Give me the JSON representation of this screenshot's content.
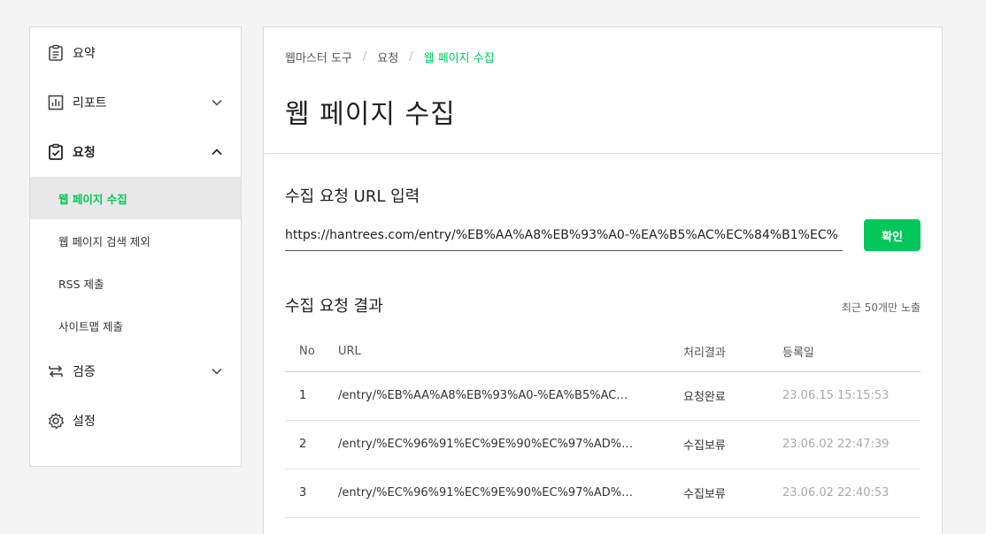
{
  "sidebar": {
    "items": [
      {
        "label": "요약",
        "icon": "clipboard-icon"
      },
      {
        "label": "리포트",
        "icon": "bar-chart-icon",
        "expanded": false
      },
      {
        "label": "요청",
        "icon": "clipboard-check-icon",
        "expanded": true,
        "children": [
          {
            "label": "웹 페이지 수집",
            "active": true
          },
          {
            "label": "웹 페이지 검색 제외"
          },
          {
            "label": "RSS 제출"
          },
          {
            "label": "사이트맵 제출"
          }
        ]
      },
      {
        "label": "검증",
        "icon": "swap-arrows-icon",
        "expanded": false
      },
      {
        "label": "설정",
        "icon": "gear-icon"
      }
    ]
  },
  "breadcrumb": [
    "웹마스터 도구",
    "요청",
    "웹 페이지 수집"
  ],
  "page_title": "웹 페이지 수집",
  "request": {
    "title": "수집 요청 URL 입력",
    "url_value": "https://hantrees.com/entry/%EB%AA%A8%EB%93%A0-%EA%B5%AC%EC%84%B1%EC%",
    "confirm_label": "확인"
  },
  "results": {
    "title": "수집 요청 결과",
    "note": "최근 50개만 노출",
    "columns": [
      "No",
      "URL",
      "처리결과",
      "등록일"
    ],
    "rows": [
      {
        "no": "1",
        "url": "/entry/%EB%AA%A8%EB%93%A0-%EA%B5%AC…",
        "status": "요청완료",
        "date": "23.06.15 15:15:53"
      },
      {
        "no": "2",
        "url": "/entry/%EC%96%91%EC%9E%90%EC%97%AD%…",
        "status": "수집보류",
        "date": "23.06.02 22:47:39"
      },
      {
        "no": "3",
        "url": "/entry/%EC%96%91%EC%9E%90%EC%97%AD%…",
        "status": "수집보류",
        "date": "23.06.02 22:40:53"
      }
    ]
  },
  "colors": {
    "accent": "#03c75a",
    "date_text": "#aaaaaa"
  }
}
